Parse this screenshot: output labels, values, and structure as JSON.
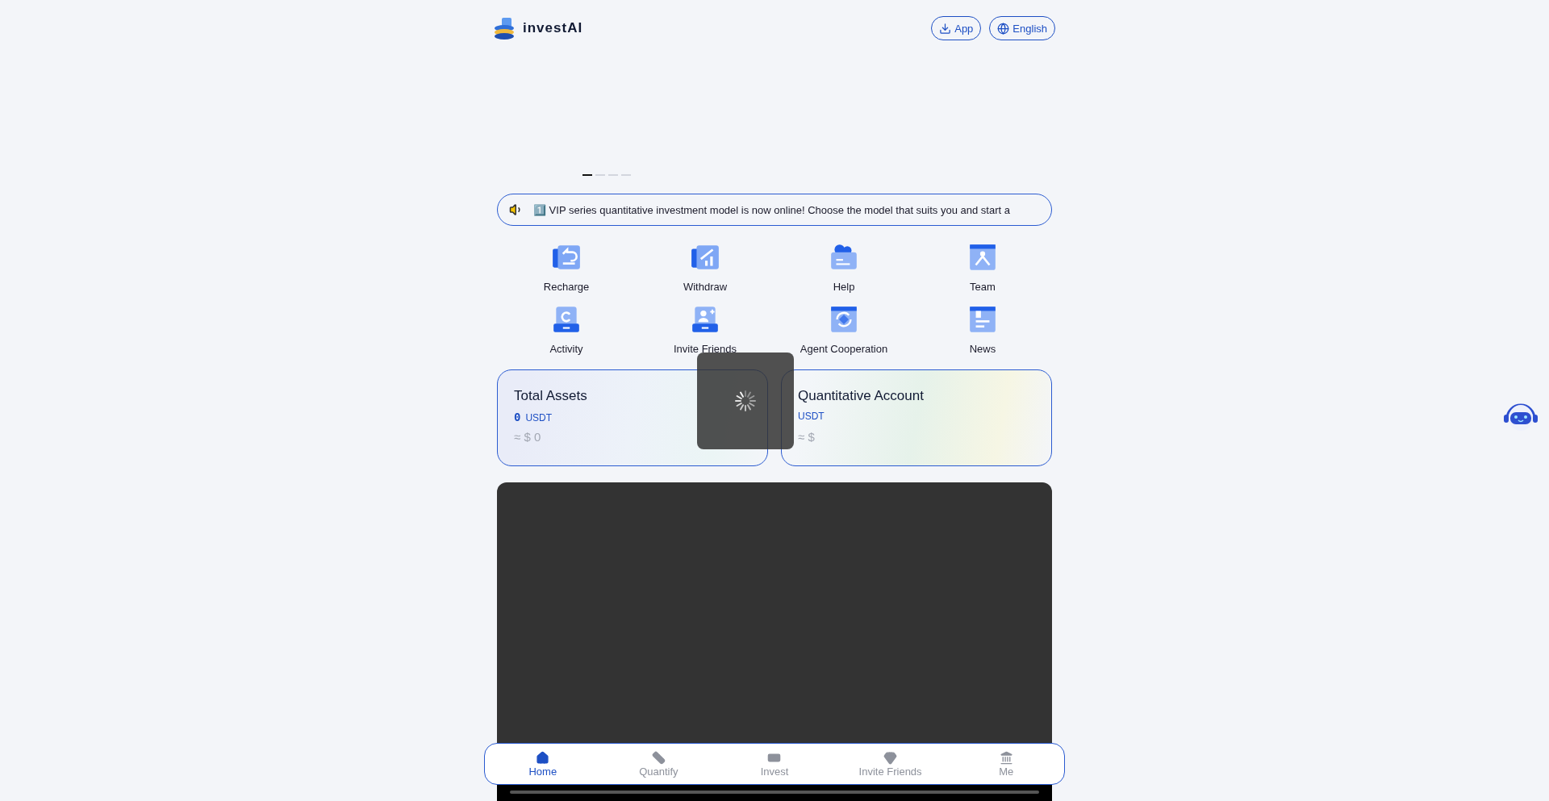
{
  "header": {
    "brand": "investAI",
    "buttons": [
      {
        "kind": "download",
        "label": "App"
      },
      {
        "kind": "language",
        "label": "English"
      }
    ]
  },
  "banner": {
    "dots": [
      {
        "selected": true
      },
      {
        "selected": false
      },
      {
        "selected": false
      },
      {
        "selected": false
      }
    ]
  },
  "notice": {
    "text": "1️⃣ VIP series quantitative investment model is now online! Choose the model that suits you and start a"
  },
  "shortcuts": [
    {
      "label": "Recharge"
    },
    {
      "label": "Withdraw"
    },
    {
      "label": "Help"
    },
    {
      "label": "Team"
    },
    {
      "label": "Activity"
    },
    {
      "label": "Invite Friends"
    },
    {
      "label": "Agent Cooperation"
    },
    {
      "label": "News"
    }
  ],
  "accounts": [
    {
      "title": "Total Assets",
      "value": "0",
      "unit": "USDT",
      "approx": "≈ $ 0"
    },
    {
      "title": "Quantitative Account",
      "unit": "USDT",
      "approx": "≈ $"
    }
  ],
  "loading": true,
  "tab_bar": [
    {
      "label": "Home",
      "selected": true
    },
    {
      "label": "Quantify",
      "selected": false
    },
    {
      "label": "Invest",
      "selected": false
    },
    {
      "label": "Invite Friends",
      "selected": false
    },
    {
      "label": "Me",
      "selected": false
    }
  ]
}
